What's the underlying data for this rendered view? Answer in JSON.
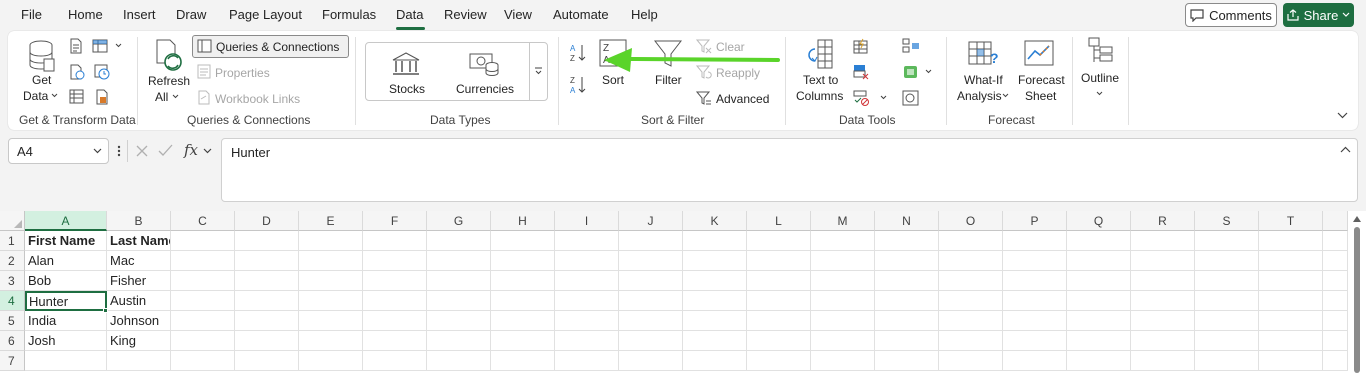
{
  "menu": {
    "tabs": [
      "File",
      "Home",
      "Insert",
      "Draw",
      "Page Layout",
      "Formulas",
      "Data",
      "Review",
      "View",
      "Automate",
      "Help"
    ],
    "active": "Data",
    "comments_label": "Comments",
    "share_label": "Share"
  },
  "ribbon": {
    "get_transform": {
      "get_data_line1": "Get",
      "get_data_line2": "Data",
      "label": "Get & Transform Data"
    },
    "queries": {
      "refresh_line1": "Refresh",
      "refresh_line2": "All",
      "queries_connections": "Queries & Connections",
      "properties": "Properties",
      "workbook_links": "Workbook Links",
      "label": "Queries & Connections"
    },
    "data_types": {
      "stocks": "Stocks",
      "currencies": "Currencies",
      "label": "Data Types"
    },
    "sort_filter": {
      "sort": "Sort",
      "filter": "Filter",
      "clear": "Clear",
      "reapply": "Reapply",
      "advanced": "Advanced",
      "label": "Sort & Filter"
    },
    "data_tools": {
      "text_to_columns_line1": "Text to",
      "text_to_columns_line2": "Columns",
      "label": "Data Tools"
    },
    "forecast": {
      "what_if_line1": "What-If",
      "what_if_line2": "Analysis",
      "forecast_sheet_line1": "Forecast",
      "forecast_sheet_line2": "Sheet",
      "label": "Forecast"
    },
    "outline": {
      "label": "Outline"
    }
  },
  "formula_bar": {
    "name_box": "A4",
    "fx": "fx",
    "content": "Hunter"
  },
  "sheet": {
    "columns": [
      "A",
      "B",
      "C",
      "D",
      "E",
      "F",
      "G",
      "H",
      "I",
      "J",
      "K",
      "L",
      "M",
      "N",
      "O",
      "P",
      "Q",
      "R",
      "S",
      "T"
    ],
    "rows": [
      "1",
      "2",
      "3",
      "4",
      "5",
      "6",
      "7"
    ],
    "col_a": [
      "First Name",
      "Alan",
      "Bob",
      "Hunter",
      "India",
      "Josh",
      ""
    ],
    "col_b": [
      "Last Name",
      "Mac",
      "Fisher",
      "Austin",
      "Johnson",
      "King",
      ""
    ],
    "active_cell": "A4"
  },
  "colors": {
    "accent": "#1e6e41",
    "annotation_arrow": "#5ad42a"
  }
}
